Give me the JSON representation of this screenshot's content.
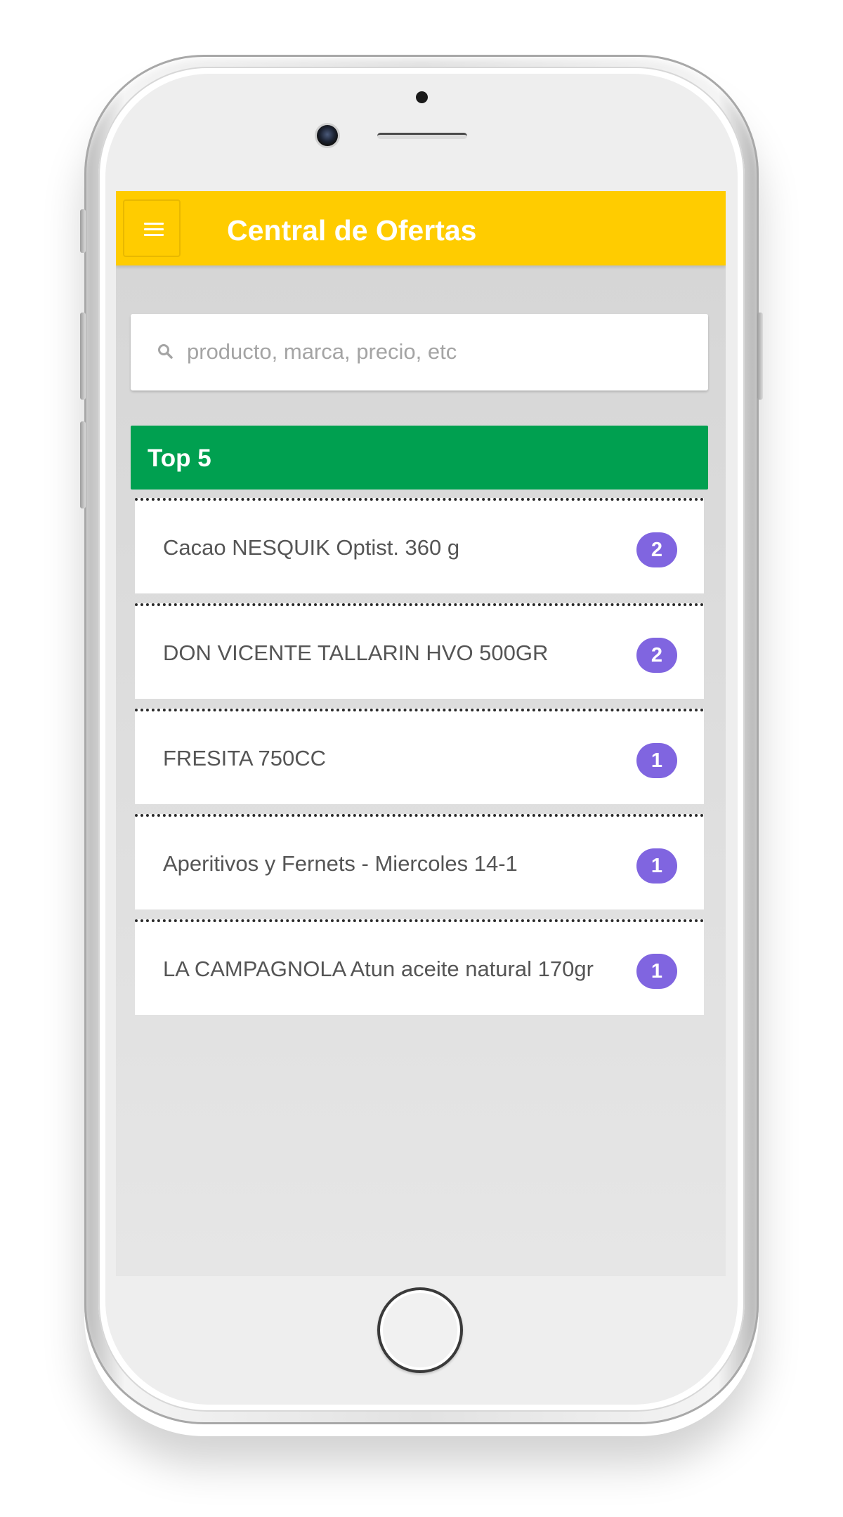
{
  "header": {
    "menu_icon": "hamburger-menu-icon",
    "title": "Central de Ofertas"
  },
  "search": {
    "icon": "search-icon",
    "placeholder": "producto, marca, precio, etc",
    "value": ""
  },
  "top_panel": {
    "title": "Top 5",
    "items": [
      {
        "label": "Cacao NESQUIK Optist. 360 g",
        "count": "2"
      },
      {
        "label": "DON VICENTE TALLARIN HVO 500GR",
        "count": "2"
      },
      {
        "label": "FRESITA 750CC",
        "count": "1"
      },
      {
        "label": "Aperitivos y Fernets - Miercoles 14-1",
        "count": "1"
      },
      {
        "label": "LA CAMPAGNOLA Atun aceite natural 170gr",
        "count": "1"
      }
    ]
  },
  "colors": {
    "header_bg": "#ffcc00",
    "panel_header_bg": "#00a050",
    "badge_bg": "#8065e0",
    "screen_bg": "#dcdcdc"
  }
}
